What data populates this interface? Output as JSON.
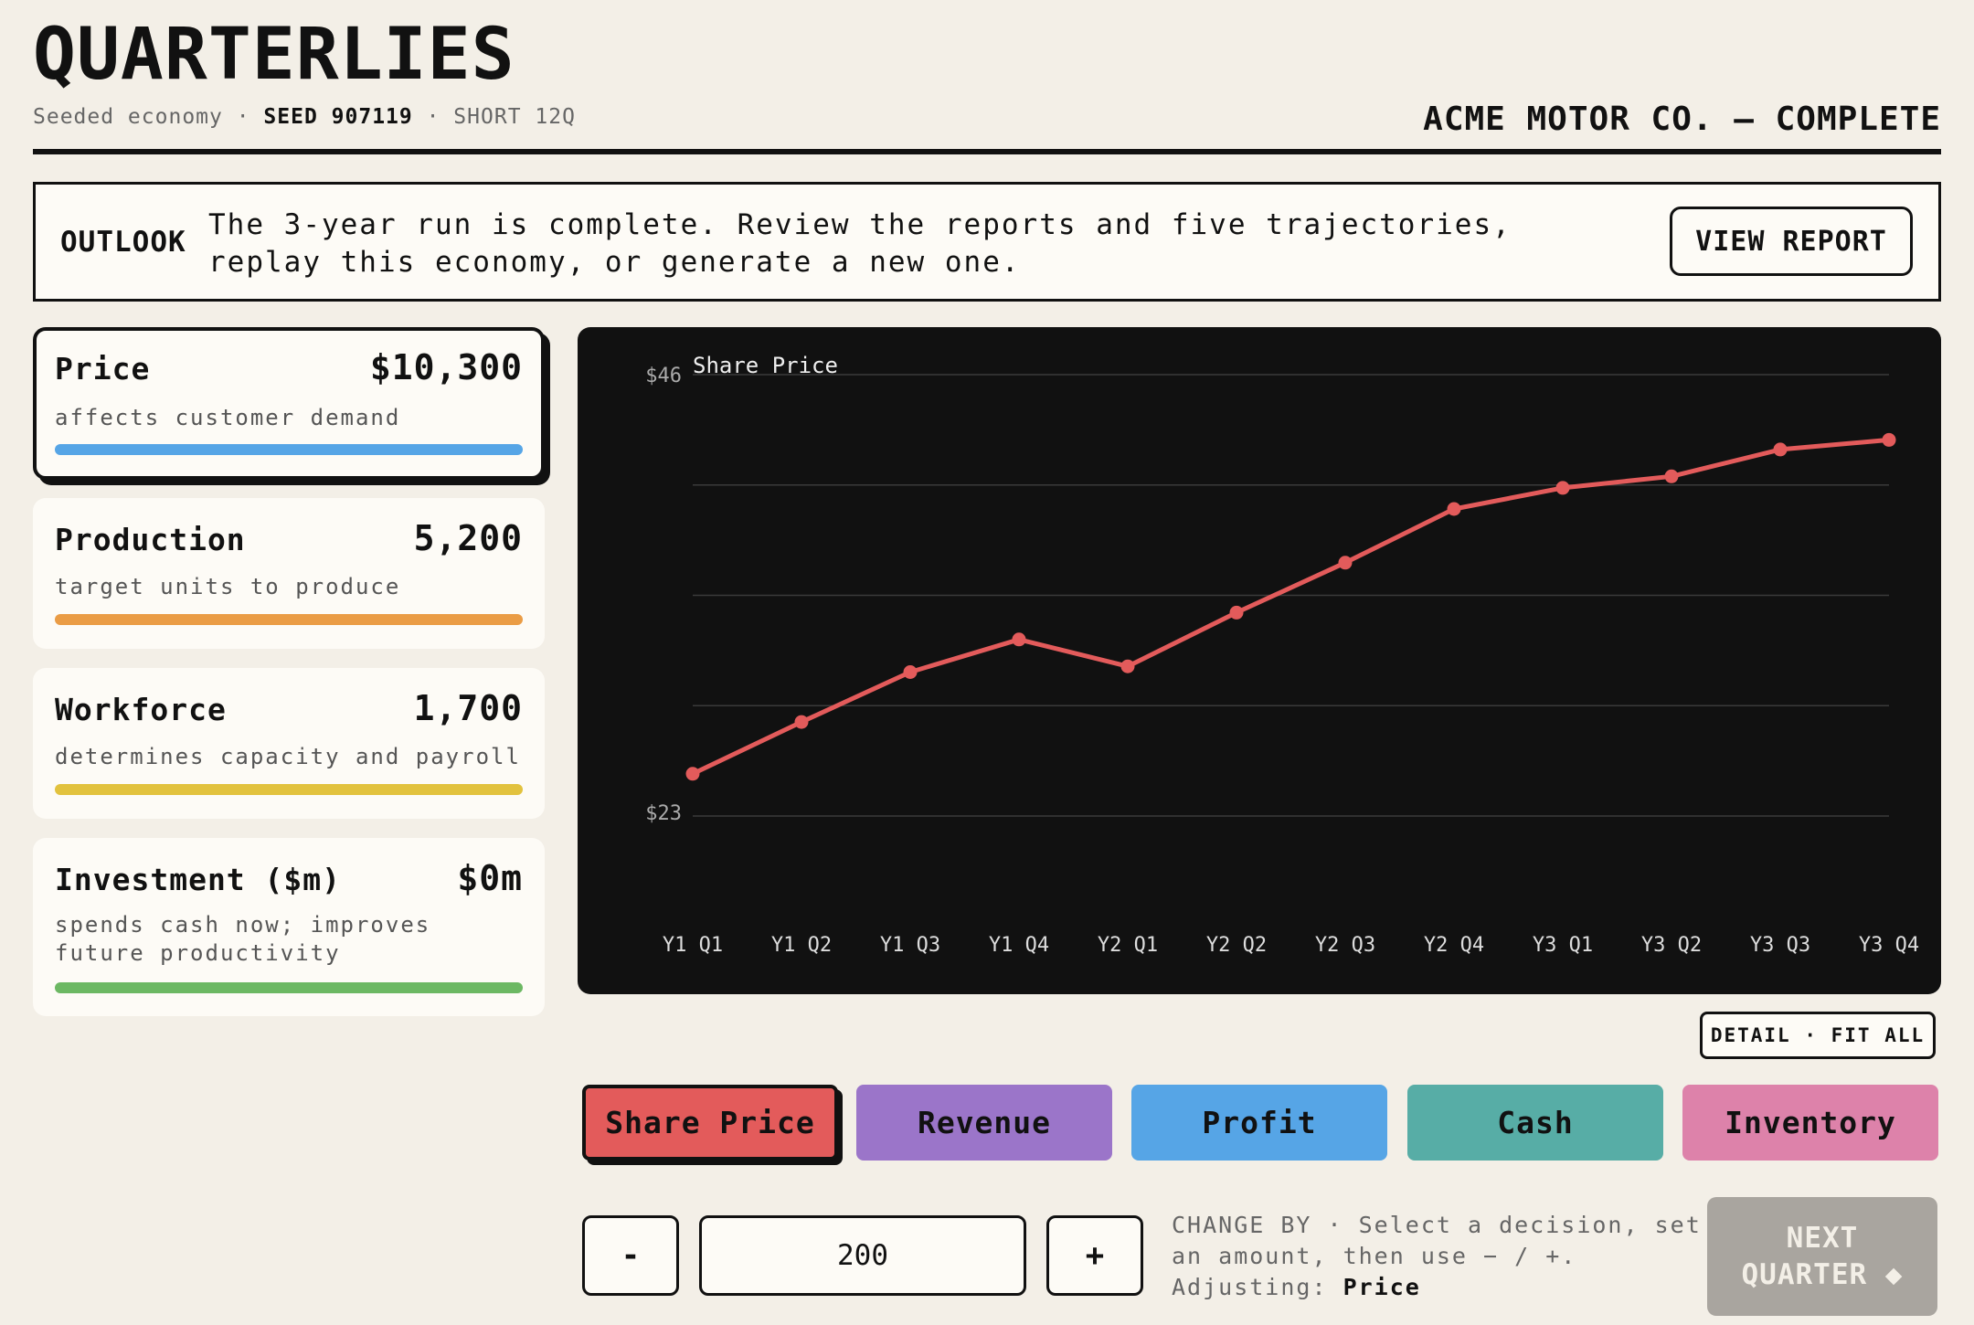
{
  "header": {
    "title": "QUARTERLIES",
    "subtitle_prefix": "Seeded economy ·",
    "seed": "SEED 907119",
    "subtitle_suffix": "· SHORT 12Q",
    "company": "ACME MOTOR CO. — COMPLETE"
  },
  "outlook": {
    "label": "OUTLOOK",
    "text": "The 3-year run is complete. Review the reports and five trajectories, replay this economy, or generate a new one.",
    "button": "VIEW REPORT"
  },
  "decisions": [
    {
      "title": "Price",
      "value": "$10,300",
      "description": "affects customer demand",
      "color": "#56a5e6",
      "selected": true
    },
    {
      "title": "Production",
      "value": "5,200",
      "description": "target units to produce",
      "color": "#ea9c45",
      "selected": false
    },
    {
      "title": "Workforce",
      "value": "1,700",
      "description": "determines capacity and payroll",
      "color": "#e2c23e",
      "selected": false
    },
    {
      "title": "Investment ($m)",
      "value": "$0m",
      "description": "spends cash now; improves future productivity",
      "color": "#6cb863",
      "selected": false
    }
  ],
  "chart_data": {
    "type": "line",
    "title": "Share Price",
    "categories": [
      "Y1 Q1",
      "Y1 Q2",
      "Y1 Q3",
      "Y1 Q4",
      "Y2 Q1",
      "Y2 Q2",
      "Y2 Q3",
      "Y2 Q4",
      "Y3 Q1",
      "Y3 Q2",
      "Y3 Q3",
      "Y3 Q4"
    ],
    "values": [
      25.2,
      27.9,
      30.5,
      32.2,
      30.8,
      33.6,
      36.2,
      39.0,
      40.1,
      40.7,
      42.1,
      42.6
    ],
    "ylim": [
      23,
      46
    ],
    "ytick_labels": [
      "$23",
      "$46"
    ],
    "grid": true,
    "color": "#e35b5b"
  },
  "detail_toggle": "DETAIL · FIT ALL",
  "metrics": [
    {
      "label": "Share Price",
      "color": "#e35b5b",
      "active": true
    },
    {
      "label": "Revenue",
      "color": "#9b75c9",
      "active": false
    },
    {
      "label": "Profit",
      "color": "#56a5e6",
      "active": false
    },
    {
      "label": "Cash",
      "color": "#57ada6",
      "active": false
    },
    {
      "label": "Inventory",
      "color": "#dd82aa",
      "active": false
    }
  ],
  "controls": {
    "minus": "-",
    "plus": "+",
    "amount": "200",
    "help_text": "CHANGE BY · Select a decision, set an amount, then use − / +.",
    "adjusting_prefix": "Adjusting:",
    "adjusting_value": "Price",
    "next_line1": "NEXT",
    "next_line2": "QUARTER ◆"
  }
}
